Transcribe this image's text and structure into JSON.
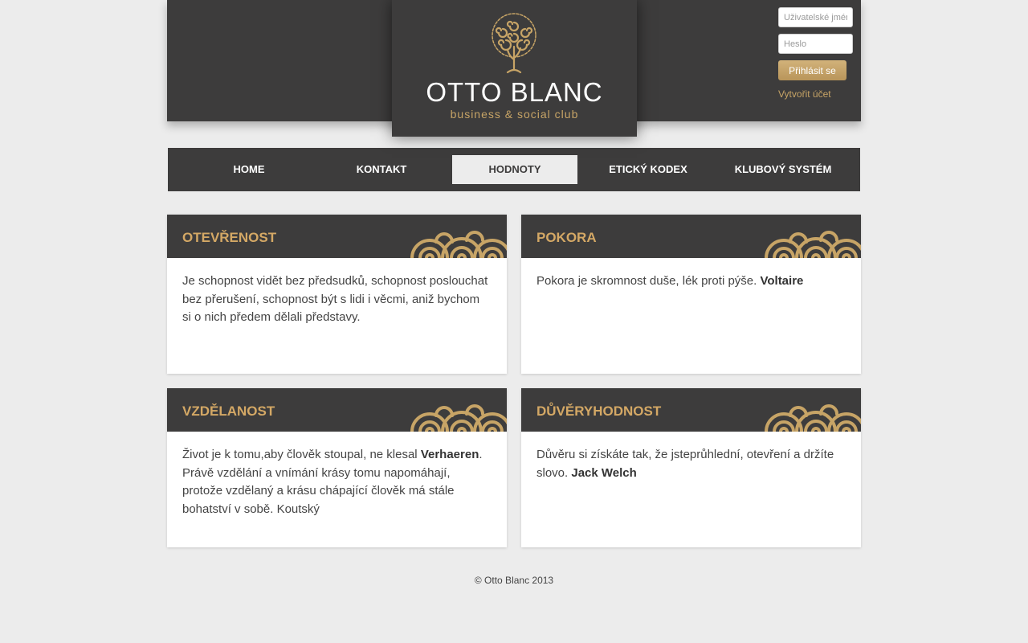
{
  "brand": {
    "name": "OTTO BLANC",
    "tagline": "business & social club",
    "gold": "#c7a466",
    "dark": "#3d3c3c"
  },
  "login": {
    "username_placeholder": "Uživatelské jméno",
    "password_placeholder": "Heslo",
    "submit_label": "Přihlásit se",
    "register_label": "Vytvořit účet"
  },
  "nav": {
    "items": [
      {
        "label": "HOME"
      },
      {
        "label": "KONTAKT"
      },
      {
        "label": "HODNOTY",
        "active": true
      },
      {
        "label": "ETICKÝ KODEX"
      },
      {
        "label": "KLUBOVÝ SYSTÉM"
      }
    ]
  },
  "cards": [
    {
      "title": "OTEVŘENOST",
      "text": "Je schopnost vidět bez předsudků, schopnost poslouchat bez přerušení, schopnost být s lidi i věcmi, aniž bychom si o nich předem dělali představy."
    },
    {
      "title": "POKORA",
      "text": "Pokora je skromnost duše, lék proti pýše.",
      "author": "Voltaire"
    },
    {
      "title": "VZDĚLANOST",
      "text_before": "Život je k tomu,aby člověk stoupal, ne klesal",
      "author": "Verhaeren",
      "text_after": ". Právě vzdělání a vnímání krásy tomu napomáhají, protože vzdělaný a krásu chápající člověk má stále bohatství v sobě. Koutský"
    },
    {
      "title": "DŮVĚRYHODNOST",
      "text": "Důvěru si získáte tak, že jsteprůhlední, otevření a držíte slovo.",
      "author": "Jack Welch"
    }
  ],
  "footer": {
    "copyright": "© Otto Blanc 2013"
  }
}
